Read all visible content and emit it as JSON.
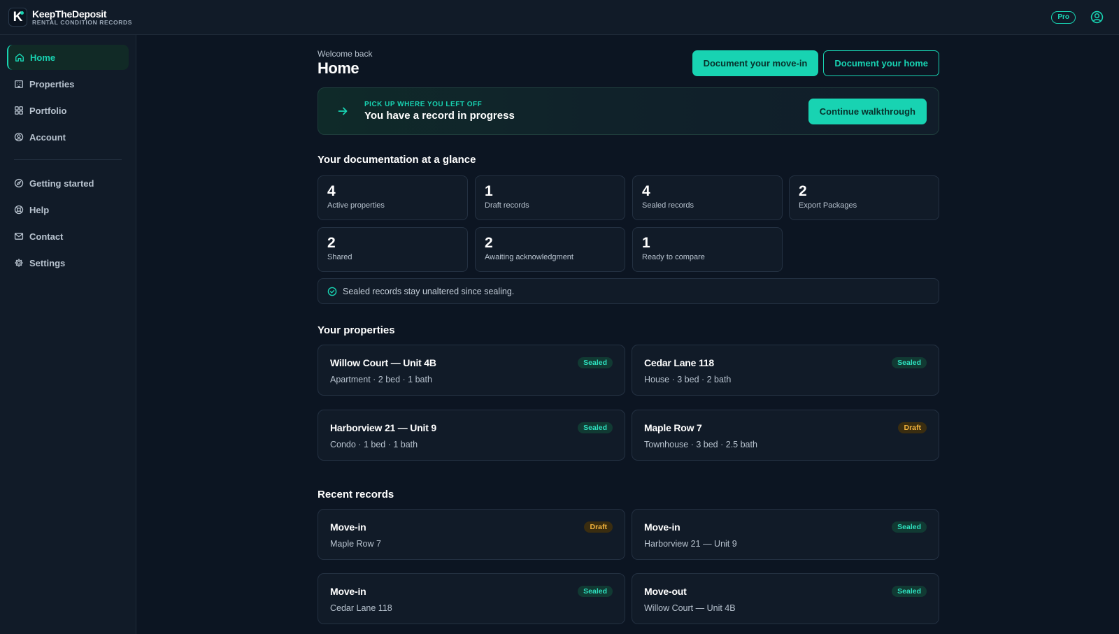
{
  "brand": {
    "name": "KeepTheDeposit",
    "tagline": "RENTAL CONDITION RECORDS",
    "logo_letter": "K"
  },
  "topbar": {
    "plan_badge": "Pro",
    "user_icon": "user-circle-icon"
  },
  "sidebar": {
    "items": [
      {
        "label": "Home",
        "icon": "home-icon",
        "active": true
      },
      {
        "label": "Properties",
        "icon": "building-icon"
      },
      {
        "label": "Portfolio",
        "icon": "grid-icon"
      },
      {
        "label": "Account",
        "icon": "user-circle-icon"
      }
    ],
    "secondary": [
      {
        "label": "Getting started",
        "icon": "compass-icon"
      },
      {
        "label": "Help",
        "icon": "lifebuoy-icon"
      },
      {
        "label": "Contact",
        "icon": "mail-icon"
      },
      {
        "label": "Settings",
        "icon": "gear-icon"
      }
    ]
  },
  "header": {
    "welcome": "Welcome back",
    "title": "Home",
    "primary_button": "Document your move-in",
    "secondary_button": "Document your home"
  },
  "resume": {
    "eyebrow": "PICK UP WHERE YOU LEFT OFF",
    "title": "You have a record in progress",
    "button": "Continue walkthrough"
  },
  "glance": {
    "title": "Your documentation at a glance",
    "stats": [
      {
        "value": "4",
        "label": "Active properties"
      },
      {
        "value": "1",
        "label": "Draft records"
      },
      {
        "value": "4",
        "label": "Sealed records"
      },
      {
        "value": "2",
        "label": "Export Packages"
      },
      {
        "value": "2",
        "label": "Shared"
      },
      {
        "value": "2",
        "label": "Awaiting acknowledgment"
      },
      {
        "value": "1",
        "label": "Ready to compare"
      }
    ],
    "notice": "Sealed records stay unaltered since sealing."
  },
  "properties": {
    "title": "Your properties",
    "items": [
      {
        "name": "Willow Court — Unit 4B",
        "details": "Apartment · 2 bed · 1 bath",
        "status": "Sealed"
      },
      {
        "name": "Cedar Lane 118",
        "details": "House · 3 bed · 2 bath",
        "status": "Sealed"
      },
      {
        "name": "Harborview 21 — Unit 9",
        "details": "Condo · 1 bed · 1 bath",
        "status": "Sealed"
      },
      {
        "name": "Maple Row 7",
        "details": "Townhouse · 3 bed · 2.5 bath",
        "status": "Draft"
      }
    ]
  },
  "records": {
    "title": "Recent records",
    "items": [
      {
        "type": "Move-in",
        "property": "Maple Row 7",
        "status": "Draft"
      },
      {
        "type": "Move-in",
        "property": "Harborview 21 — Unit 9",
        "status": "Sealed"
      },
      {
        "type": "Move-in",
        "property": "Cedar Lane 118",
        "status": "Sealed"
      },
      {
        "type": "Move-out",
        "property": "Willow Court — Unit 4B",
        "status": "Sealed"
      }
    ]
  },
  "colors": {
    "accent": "#18d3b2",
    "background": "#0c1522",
    "panel": "#111b28",
    "draft": "#f2b33d"
  }
}
